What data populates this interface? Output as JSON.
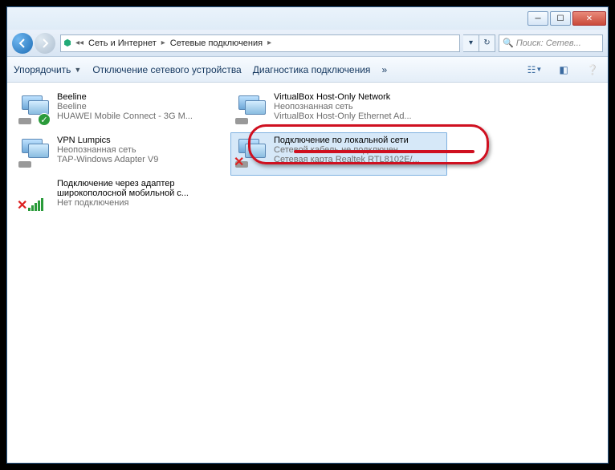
{
  "breadcrumb": {
    "root": "Сеть и Интернет",
    "current": "Сетевые подключения"
  },
  "search": {
    "placeholder": "Поиск: Сетев..."
  },
  "toolbar": {
    "organize": "Упорядочить",
    "disable": "Отключение сетевого устройства",
    "diagnose": "Диагностика подключения",
    "more": "»"
  },
  "items": [
    {
      "title": "Beeline",
      "sub1": "Beeline",
      "sub2": "HUAWEI Mobile Connect - 3G M...",
      "badge": "ok"
    },
    {
      "title": "VPN Lumpics",
      "sub1": "Неопознанная сеть",
      "sub2": "TAP-Windows Adapter V9",
      "badge": "none"
    },
    {
      "title": "Подключение через адаптер широкополосной мобильной с...",
      "sub1": "Нет подключения",
      "sub2": "",
      "badge": "bars-x"
    },
    {
      "title": "VirtualBox Host-Only Network",
      "sub1": "Неопознанная сеть",
      "sub2": "VirtualBox Host-Only Ethernet Ad...",
      "badge": "none"
    },
    {
      "title": "Подключение по локальной сети",
      "sub1": "Сетевой кабель не подключен",
      "sub2": "Сетевая карта Realtek RTL8102E/...",
      "badge": "x",
      "selected": true
    }
  ]
}
